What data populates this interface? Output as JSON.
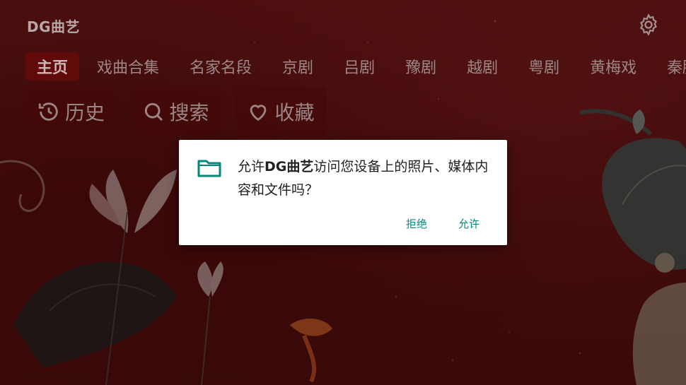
{
  "app": {
    "title": "DG曲艺",
    "settings_icon": "gear-icon"
  },
  "tabs": [
    {
      "label": "主页",
      "active": true
    },
    {
      "label": "戏曲合集",
      "active": false
    },
    {
      "label": "名家名段",
      "active": false
    },
    {
      "label": "京剧",
      "active": false
    },
    {
      "label": "吕剧",
      "active": false
    },
    {
      "label": "豫剧",
      "active": false
    },
    {
      "label": "越剧",
      "active": false
    },
    {
      "label": "粤剧",
      "active": false
    },
    {
      "label": "黄梅戏",
      "active": false
    },
    {
      "label": "秦腔",
      "active": false
    }
  ],
  "quick_actions": [
    {
      "label": "历史",
      "icon": "history-icon"
    },
    {
      "label": "搜索",
      "icon": "search-icon"
    },
    {
      "label": "收藏",
      "icon": "heart-icon"
    }
  ],
  "dialog": {
    "icon": "folder-icon",
    "message_prefix": "允许",
    "message_app": "DG曲艺",
    "message_suffix": "访问您设备上的照片、媒体内容和文件吗？",
    "deny_label": "拒绝",
    "allow_label": "允许",
    "accent_color": "#00897b"
  }
}
